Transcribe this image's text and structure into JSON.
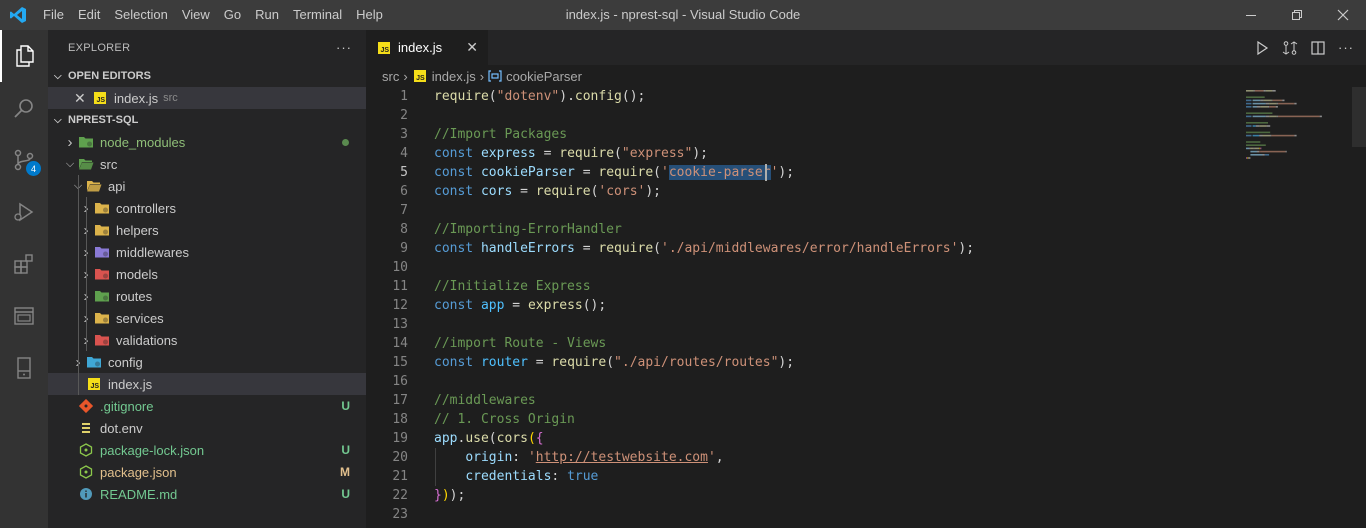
{
  "titlebar": {
    "menu": [
      "File",
      "Edit",
      "Selection",
      "View",
      "Go",
      "Run",
      "Terminal",
      "Help"
    ],
    "title": "index.js - nprest-sql - Visual Studio Code"
  },
  "activitybar": {
    "items": [
      "explorer-icon",
      "search-icon",
      "source-control-icon",
      "run-debug-icon",
      "extensions-icon",
      "remote-explorer-icon",
      "device-icon"
    ],
    "scm_badge": "4"
  },
  "sidebar": {
    "title": "EXPLORER",
    "more": "···",
    "open_editors": {
      "header": "OPEN EDITORS",
      "items": [
        {
          "name": "index.js",
          "desc": "src"
        }
      ]
    },
    "project": {
      "header": "NPREST-SQL",
      "items": [
        {
          "name": "node_modules",
          "level": 1,
          "type": "folder",
          "expanded": false,
          "icon": "green",
          "status": "dot"
        },
        {
          "name": "src",
          "level": 1,
          "type": "folder",
          "expanded": true,
          "icon": "green"
        },
        {
          "name": "api",
          "level": 2,
          "type": "folder",
          "expanded": true,
          "icon": "yellow"
        },
        {
          "name": "controllers",
          "level": 3,
          "type": "folder",
          "expanded": false,
          "icon": "yellow"
        },
        {
          "name": "helpers",
          "level": 3,
          "type": "folder",
          "expanded": false,
          "icon": "yellow"
        },
        {
          "name": "middlewares",
          "level": 3,
          "type": "folder",
          "expanded": false,
          "icon": "purple"
        },
        {
          "name": "models",
          "level": 3,
          "type": "folder",
          "expanded": false,
          "icon": "red"
        },
        {
          "name": "routes",
          "level": 3,
          "type": "folder",
          "expanded": false,
          "icon": "green"
        },
        {
          "name": "services",
          "level": 3,
          "type": "folder",
          "expanded": false,
          "icon": "yellow"
        },
        {
          "name": "validations",
          "level": 3,
          "type": "folder",
          "expanded": false,
          "icon": "red"
        },
        {
          "name": "config",
          "level": 2,
          "type": "folder",
          "expanded": false,
          "icon": "blue"
        },
        {
          "name": "index.js",
          "level": 2,
          "type": "js",
          "selected": true
        },
        {
          "name": ".gitignore",
          "level": 1,
          "type": "git",
          "status": "U"
        },
        {
          "name": "dot.env",
          "level": 1,
          "type": "env"
        },
        {
          "name": "package-lock.json",
          "level": 1,
          "type": "npm",
          "status": "U"
        },
        {
          "name": "package.json",
          "level": 1,
          "type": "npm",
          "status": "M"
        },
        {
          "name": "README.md",
          "level": 1,
          "type": "info",
          "status": "U"
        }
      ]
    }
  },
  "tab": {
    "label": "index.js",
    "close": "✕"
  },
  "breadcrumb": {
    "folder": "src",
    "file": "index.js",
    "symbol": "cookieParser"
  },
  "editor": {
    "current_line": 5,
    "lines": [
      [
        [
          "fn",
          "require"
        ],
        [
          "p",
          "("
        ],
        [
          "str",
          "\"dotenv\""
        ],
        [
          "p",
          ")."
        ],
        [
          "fn",
          "config"
        ],
        [
          "p",
          "();"
        ]
      ],
      [],
      [
        [
          "cm",
          "//Import Packages"
        ]
      ],
      [
        [
          "kw",
          "const"
        ],
        [
          "p",
          " "
        ],
        [
          "var",
          "express"
        ],
        [
          "p",
          " = "
        ],
        [
          "fn",
          "require"
        ],
        [
          "p",
          "("
        ],
        [
          "str",
          "\"express\""
        ],
        [
          "p",
          ");"
        ]
      ],
      [
        [
          "kw",
          "const"
        ],
        [
          "p",
          " "
        ],
        [
          "var",
          "cookieParser"
        ],
        [
          "p",
          " = "
        ],
        [
          "fn",
          "require"
        ],
        [
          "p",
          "("
        ],
        [
          "str",
          "'"
        ],
        [
          "strhl",
          "cookie-parser"
        ],
        [
          "str",
          "'"
        ],
        [
          "p",
          ");"
        ]
      ],
      [
        [
          "kw",
          "const"
        ],
        [
          "p",
          " "
        ],
        [
          "var",
          "cors"
        ],
        [
          "p",
          " = "
        ],
        [
          "fn",
          "require"
        ],
        [
          "p",
          "("
        ],
        [
          "str",
          "'cors'"
        ],
        [
          "p",
          ");"
        ]
      ],
      [],
      [
        [
          "cm",
          "//Importing-ErrorHandler"
        ]
      ],
      [
        [
          "kw",
          "const"
        ],
        [
          "p",
          " "
        ],
        [
          "var",
          "handleErrors"
        ],
        [
          "p",
          " = "
        ],
        [
          "fn",
          "require"
        ],
        [
          "p",
          "("
        ],
        [
          "str",
          "'./api/middlewares/error/handleErrors'"
        ],
        [
          "p",
          ");"
        ]
      ],
      [],
      [
        [
          "cm",
          "//Initialize Express"
        ]
      ],
      [
        [
          "kw",
          "const"
        ],
        [
          "p",
          " "
        ],
        [
          "cst",
          "app"
        ],
        [
          "p",
          " = "
        ],
        [
          "fn",
          "express"
        ],
        [
          "p",
          "();"
        ]
      ],
      [],
      [
        [
          "cm",
          "//import Route - Views"
        ]
      ],
      [
        [
          "kw",
          "const"
        ],
        [
          "p",
          " "
        ],
        [
          "cst",
          "router"
        ],
        [
          "p",
          " = "
        ],
        [
          "fn",
          "require"
        ],
        [
          "p",
          "("
        ],
        [
          "str",
          "\"./api/routes/routes\""
        ],
        [
          "p",
          ");"
        ]
      ],
      [],
      [
        [
          "cm",
          "//middlewares"
        ]
      ],
      [
        [
          "cm",
          "// 1. Cross Origin"
        ]
      ],
      [
        [
          "var",
          "app"
        ],
        [
          "p",
          "."
        ],
        [
          "fn",
          "use"
        ],
        [
          "p",
          "("
        ],
        [
          "fn",
          "cors"
        ],
        [
          "b1",
          "("
        ],
        [
          "b2",
          "{"
        ]
      ],
      [
        [
          "p",
          "    "
        ],
        [
          "var",
          "origin"
        ],
        [
          "p",
          ": "
        ],
        [
          "str",
          "'"
        ],
        [
          "strlink",
          "http://testwebsite.com"
        ],
        [
          "str",
          "'"
        ],
        [
          "p",
          ","
        ]
      ],
      [
        [
          "p",
          "    "
        ],
        [
          "var",
          "credentials"
        ],
        [
          "p",
          ": "
        ],
        [
          "kw",
          "true"
        ]
      ],
      [
        [
          "b2",
          "}"
        ],
        [
          "b1",
          ")"
        ],
        [
          "p",
          ");"
        ]
      ],
      []
    ]
  },
  "colors": {
    "accent": "#007acc",
    "git_untracked": "#73c991",
    "git_modified": "#e2c08d"
  }
}
